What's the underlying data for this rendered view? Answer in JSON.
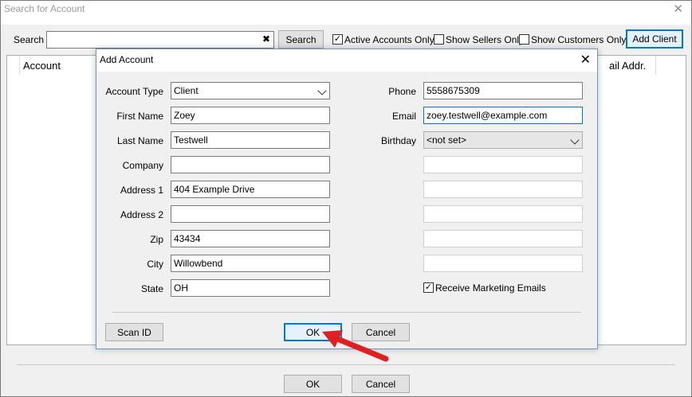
{
  "window": {
    "title": "Search for Account",
    "close": "✕"
  },
  "search": {
    "label": "Search",
    "value": "",
    "clear_glyph": "✖",
    "button": "Search",
    "active_only": {
      "label": "Active Accounts Only",
      "checked": true
    },
    "sellers_only": {
      "label": "Show Sellers Only",
      "checked": false
    },
    "customers_only": {
      "label": "Show Customers Only",
      "checked": false
    },
    "add_client": "Add Client"
  },
  "results": {
    "columns": [
      "Account",
      "ail Addr."
    ]
  },
  "dialog": {
    "title": "Add Account",
    "close": "✕",
    "fields": {
      "account_type": {
        "label": "Account Type",
        "value": "Client"
      },
      "first_name": {
        "label": "First Name",
        "value": "Zoey"
      },
      "last_name": {
        "label": "Last Name",
        "value": "Testwell"
      },
      "company": {
        "label": "Company",
        "value": ""
      },
      "address1": {
        "label": "Address 1",
        "value": "404 Example Drive"
      },
      "address2": {
        "label": "Address 2",
        "value": ""
      },
      "zip": {
        "label": "Zip",
        "value": "43434"
      },
      "city": {
        "label": "City",
        "value": "Willowbend"
      },
      "state": {
        "label": "State",
        "value": "OH"
      },
      "phone": {
        "label": "Phone",
        "value": "5558675309"
      },
      "email": {
        "label": "Email",
        "value": "zoey.testwell@example.com"
      },
      "birthday": {
        "label": "Birthday",
        "value": "<not set>"
      }
    },
    "marketing": {
      "label": "Receive Marketing Emails",
      "checked": true
    },
    "buttons": {
      "scan_id": "Scan ID",
      "ok": "OK",
      "cancel": "Cancel"
    }
  },
  "footer": {
    "ok": "OK",
    "cancel": "Cancel"
  },
  "check_glyph": "✓",
  "annotation": {
    "color": "#e02020",
    "icon": "red-arrow-icon"
  }
}
